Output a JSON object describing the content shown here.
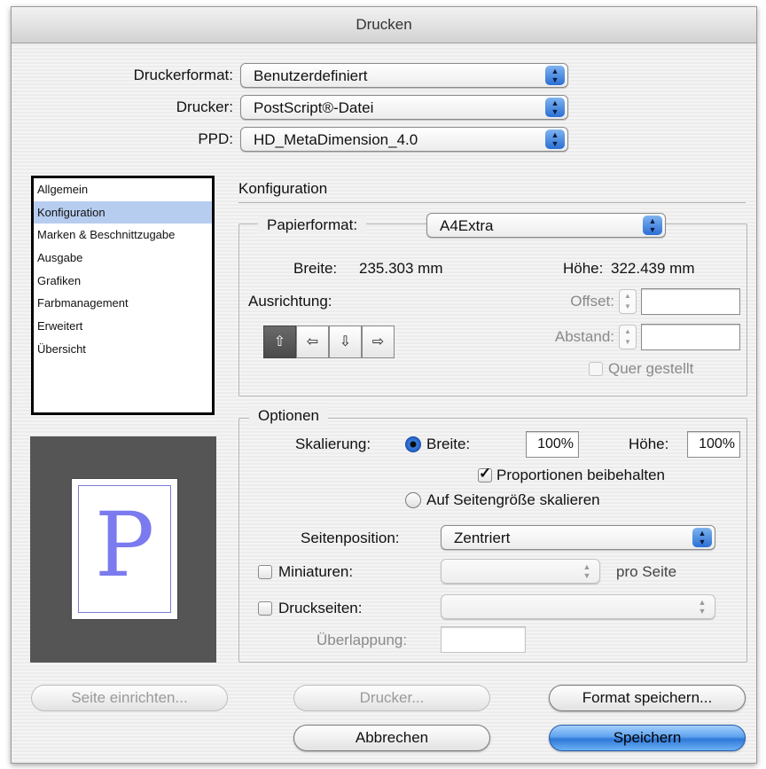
{
  "window": {
    "title": "Drucken"
  },
  "header": {
    "printer_preset_label": "Druckerformat:",
    "printer_preset_value": "Benutzerdefiniert",
    "printer_label": "Drucker:",
    "printer_value": "PostScript®-Datei",
    "ppd_label": "PPD:",
    "ppd_value": "HD_MetaDimension_4.0"
  },
  "sidebar": {
    "items": [
      {
        "label": "Allgemein",
        "selected": false
      },
      {
        "label": "Konfiguration",
        "selected": true
      },
      {
        "label": "Marken & Beschnittzugabe",
        "selected": false
      },
      {
        "label": "Ausgabe",
        "selected": false
      },
      {
        "label": "Grafiken",
        "selected": false
      },
      {
        "label": "Farbmanagement",
        "selected": false
      },
      {
        "label": "Erweitert",
        "selected": false
      },
      {
        "label": "Übersicht",
        "selected": false
      }
    ],
    "preview_glyph": "P"
  },
  "config": {
    "section_title": "Konfiguration",
    "paper_size_label": "Papierformat:",
    "paper_size_value": "A4Extra",
    "width_label": "Breite:",
    "width_value": "235.303 mm",
    "height_label": "Höhe:",
    "height_value": "322.439 mm",
    "orientation_label": "Ausrichtung:",
    "offset_label": "Offset:",
    "offset_value": "",
    "gap_label": "Abstand:",
    "gap_value": "",
    "transverse_label": "Quer gestellt",
    "transverse_checked": false
  },
  "options": {
    "section_title": "Optionen",
    "scaling_label": "Skalierung:",
    "width_radio_label": "Breite:",
    "width_value": "100%",
    "height_label": "Höhe:",
    "height_value": "100%",
    "keep_proportions_label": "Proportionen beibehalten",
    "keep_proportions_checked": true,
    "fit_to_page_label": "Auf Seitengröße skalieren",
    "page_position_label": "Seitenposition:",
    "page_position_value": "Zentriert",
    "thumbnails_label": "Miniaturen:",
    "thumbnails_value": "",
    "per_page_label": "pro Seite",
    "tiles_label": "Druckseiten:",
    "tiles_value": "",
    "overlap_label": "Überlappung:",
    "overlap_value": ""
  },
  "buttons": {
    "page_setup": "Seite einrichten...",
    "printer": "Drucker...",
    "save_preset": "Format speichern...",
    "cancel": "Abbrechen",
    "save": "Speichern"
  },
  "colors": {
    "accent": "#2f78d8",
    "list_selection": "#b7cdf0",
    "preview_glyph": "#7b7bef"
  }
}
